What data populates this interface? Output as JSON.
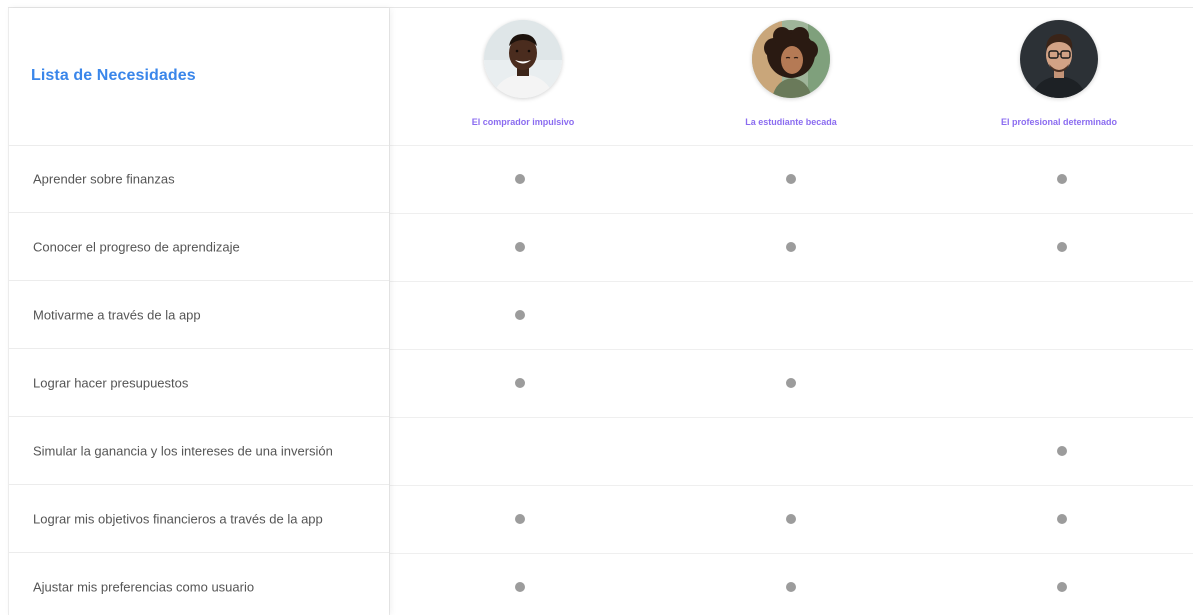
{
  "title": "Lista de Necesidades",
  "personas": [
    {
      "name": "El comprador impulsivo",
      "avatar_icon": "avatar-man-smiling"
    },
    {
      "name": "La estudiante becada",
      "avatar_icon": "avatar-woman-curly-hair"
    },
    {
      "name": "El profesional determinado",
      "avatar_icon": "avatar-man-glasses"
    }
  ],
  "needs": [
    {
      "label": "Aprender sobre finanzas",
      "marks": [
        true,
        true,
        true
      ]
    },
    {
      "label": "Conocer el progreso de aprendizaje",
      "marks": [
        true,
        true,
        true
      ]
    },
    {
      "label": "Motivarme a través de la app",
      "marks": [
        true,
        false,
        false
      ]
    },
    {
      "label": "Lograr hacer presupuestos",
      "marks": [
        true,
        true,
        false
      ]
    },
    {
      "label": "Simular la ganancia y los intereses de una inversión",
      "marks": [
        false,
        false,
        true
      ]
    },
    {
      "label": "Lograr mis objetivos financieros a través de la app",
      "marks": [
        true,
        true,
        true
      ]
    },
    {
      "label": "Ajustar mis preferencias como usuario",
      "marks": [
        true,
        true,
        true
      ]
    }
  ],
  "colors": {
    "title": "#3a86ea",
    "persona_name": "#8b6cf0",
    "dot": "#9c9c9c"
  }
}
